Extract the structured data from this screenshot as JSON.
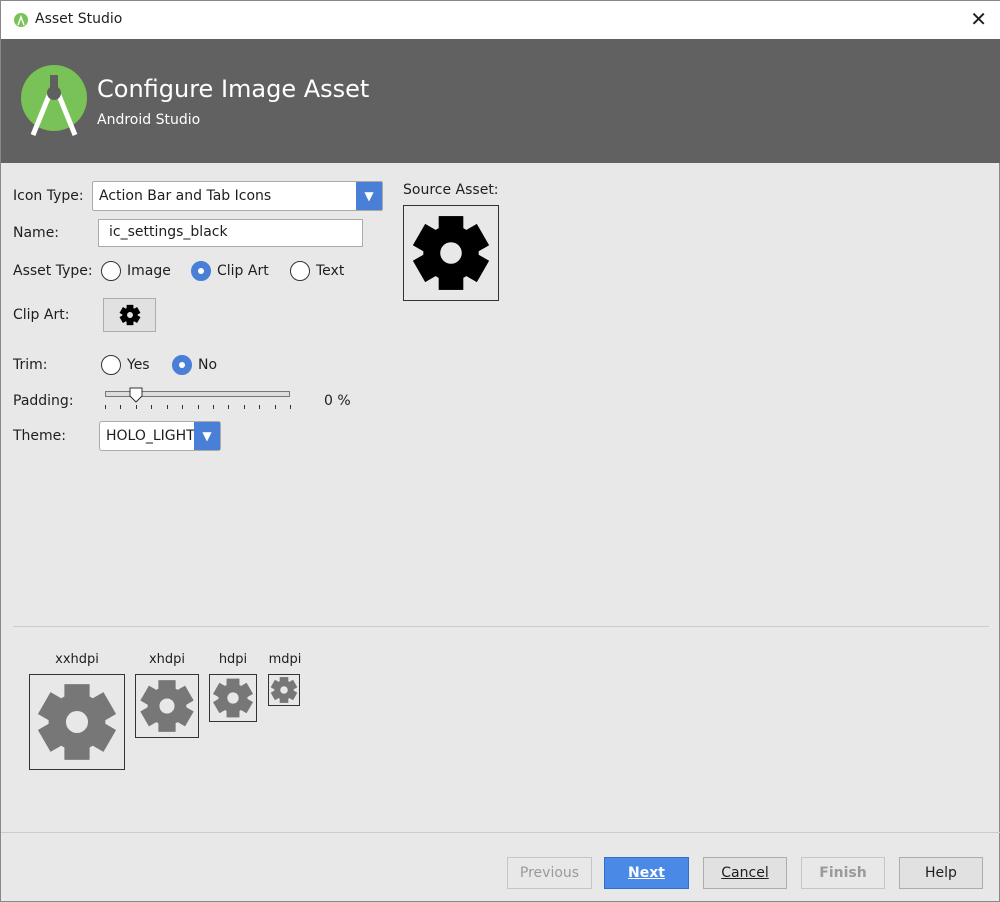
{
  "window": {
    "title": "Asset Studio",
    "close": "✕"
  },
  "banner": {
    "title": "Configure Image Asset",
    "subtitle": "Android Studio"
  },
  "form": {
    "icon_type_label": "Icon Type:",
    "icon_type_value": "Action Bar and Tab Icons",
    "name_label": "Name:",
    "name_value": "ic_settings_black",
    "asset_type_label": "Asset Type:",
    "asset_types": [
      "Image",
      "Clip Art",
      "Text"
    ],
    "asset_type_selected": "Clip Art",
    "clip_art_label": "Clip Art:",
    "trim_label": "Trim:",
    "trim_options": [
      "Yes",
      "No"
    ],
    "trim_selected": "No",
    "padding_label": "Padding:",
    "padding_value": "0 %",
    "padding_slider_fraction": 0.17,
    "theme_label": "Theme:",
    "theme_value": "HOLO_LIGHT"
  },
  "source_asset_label": "Source Asset:",
  "densities": [
    "xxhdpi",
    "xhdpi",
    "hdpi",
    "mdpi"
  ],
  "buttons": {
    "previous": "Previous",
    "next": "Next",
    "cancel": "Cancel",
    "finish": "Finish",
    "help": "Help"
  },
  "colors": {
    "accent": "#4a7fd8",
    "banner": "#616161",
    "logo": "#78c257"
  }
}
